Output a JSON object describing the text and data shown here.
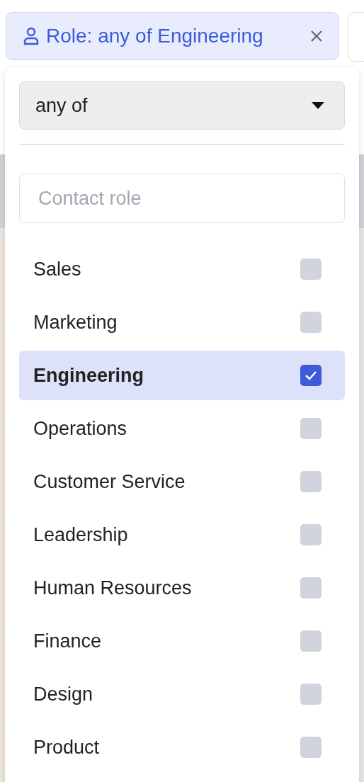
{
  "filter_chip": {
    "label": "Role: any of Engineering"
  },
  "operator_select": {
    "value": "any of"
  },
  "search": {
    "placeholder": "Contact role"
  },
  "options": [
    {
      "label": "Sales",
      "checked": false
    },
    {
      "label": "Marketing",
      "checked": false
    },
    {
      "label": "Engineering",
      "checked": true
    },
    {
      "label": "Operations",
      "checked": false
    },
    {
      "label": "Customer Service",
      "checked": false
    },
    {
      "label": "Leadership",
      "checked": false
    },
    {
      "label": "Human Resources",
      "checked": false
    },
    {
      "label": "Finance",
      "checked": false
    },
    {
      "label": "Design",
      "checked": false
    },
    {
      "label": "Product",
      "checked": false
    }
  ]
}
